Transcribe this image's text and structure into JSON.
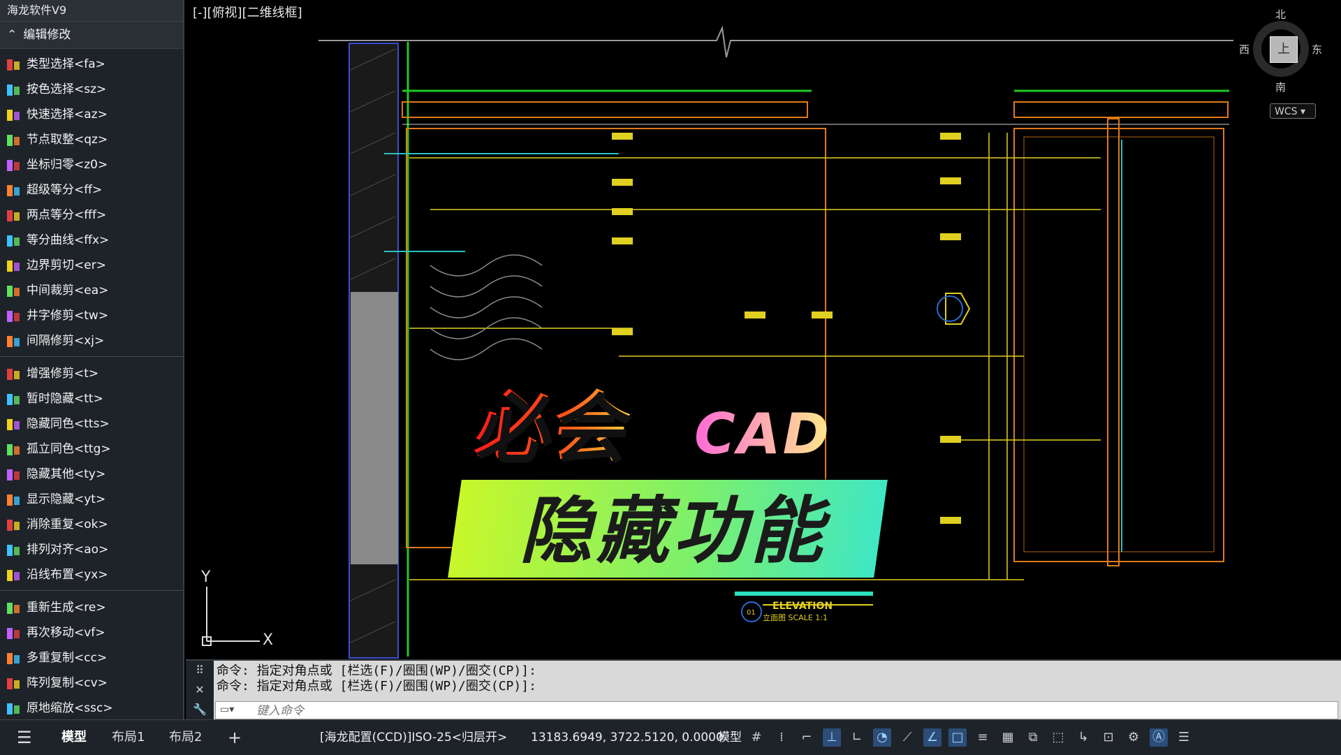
{
  "app": {
    "title": "海龙软件V9"
  },
  "sidebar": {
    "group_label": "编辑修改",
    "items": [
      {
        "label": "类型选择<fa>",
        "icon": "type-select-icon"
      },
      {
        "label": "按色选择<sz>",
        "icon": "color-select-icon"
      },
      {
        "label": "快速选择<az>",
        "icon": "quick-select-icon"
      },
      {
        "label": "节点取整<qz>",
        "icon": "node-round-icon"
      },
      {
        "label": "坐标归零<z0>",
        "icon": "coord-zero-icon"
      },
      {
        "label": "超级等分<ff>",
        "icon": "super-divide-icon"
      },
      {
        "label": "两点等分<fff>",
        "icon": "two-point-divide-icon"
      },
      {
        "label": "等分曲线<ffx>",
        "icon": "divide-curve-icon"
      },
      {
        "label": "边界剪切<er>",
        "icon": "boundary-trim-icon"
      },
      {
        "label": "中间裁剪<ea>",
        "icon": "middle-trim-icon"
      },
      {
        "label": "井字修剪<tw>",
        "icon": "grid-trim-icon"
      },
      {
        "label": "间隔修剪<xj>",
        "icon": "interval-trim-icon"
      },
      {
        "label": "增强修剪<t>",
        "icon": "enhanced-trim-icon"
      },
      {
        "label": "暂时隐藏<tt>",
        "icon": "temp-hide-icon"
      },
      {
        "label": "隐藏同色<tts>",
        "icon": "hide-same-color-icon"
      },
      {
        "label": "孤立同色<ttg>",
        "icon": "isolate-same-color-icon"
      },
      {
        "label": "隐藏其他<ty>",
        "icon": "hide-others-icon"
      },
      {
        "label": "显示隐藏<yt>",
        "icon": "show-hidden-icon"
      },
      {
        "label": "消除重复<ok>",
        "icon": "remove-duplicate-icon"
      },
      {
        "label": "排列对齐<ao>",
        "icon": "align-icon"
      },
      {
        "label": "沿线布置<yx>",
        "icon": "along-line-icon"
      },
      {
        "label": "重新生成<re>",
        "icon": "regenerate-icon"
      },
      {
        "label": "再次移动<vf>",
        "icon": "move-again-icon"
      },
      {
        "label": "多重复制<cc>",
        "icon": "multi-copy-icon"
      },
      {
        "label": "阵列复制<cv>",
        "icon": "array-copy-icon"
      },
      {
        "label": "原地缩放<ssc>",
        "icon": "scale-in-place-icon"
      }
    ]
  },
  "viewport": {
    "view_label": "[-][俯视][二维线框]",
    "navcube": {
      "north": "北",
      "south": "南",
      "east": "东",
      "west": "西",
      "face": "上",
      "wcs": "WCS"
    },
    "ucs": {
      "x": "X",
      "y": "Y"
    },
    "overlay": {
      "line1": "必会",
      "line2": "CAD",
      "banner": "隐藏功能"
    },
    "elevation": {
      "title": "ELEVATION",
      "sub": "立面图  SCALE 1:1",
      "tag": "01"
    }
  },
  "command": {
    "history": [
      "命令: 指定对角点或 [栏选(F)/圈围(WP)/圈交(CP)]:",
      "命令: 指定对角点或 [栏选(F)/圈围(WP)/圈交(CP)]:"
    ],
    "placeholder": "键入命令"
  },
  "status": {
    "tabs": [
      "模型",
      "布局1",
      "布局2"
    ],
    "active_tab": "模型",
    "config": "[海龙配置(CCD)]ISO-25<归层开>",
    "coords": "13183.6949, 3722.5120, 0.0000",
    "model_label": "模型"
  }
}
